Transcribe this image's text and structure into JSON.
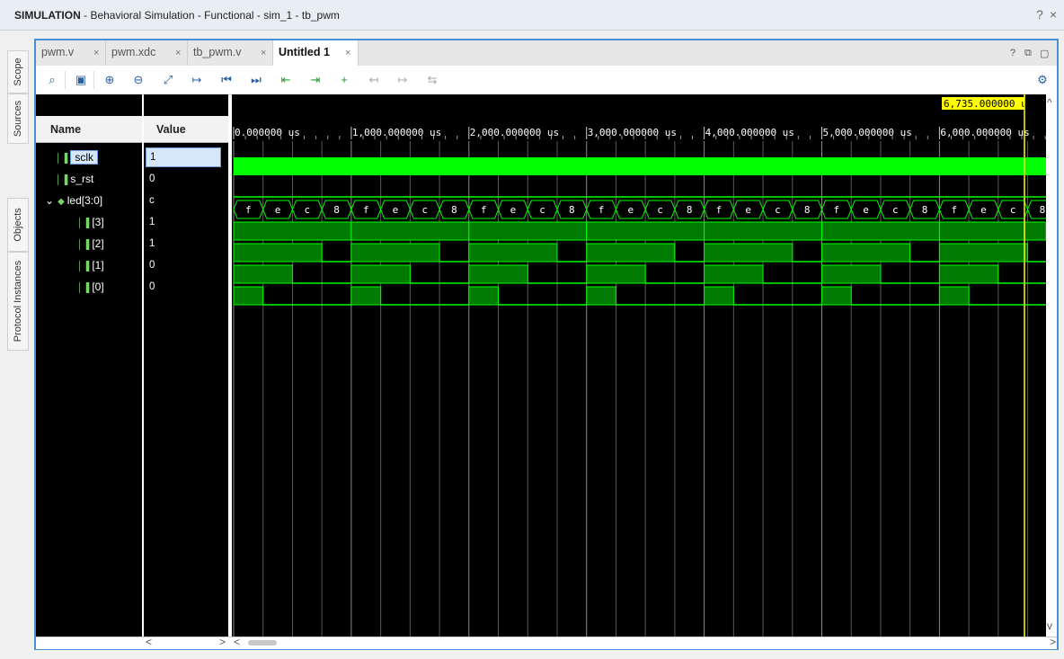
{
  "window": {
    "title_prefix": "SIMULATION",
    "title_rest": " - Behavioral Simulation - Functional - sim_1 - tb_pwm",
    "help": "?",
    "close": "×"
  },
  "side_tabs": [
    "Scope",
    "Sources",
    "Objects",
    "Protocol Instances"
  ],
  "tabs": [
    {
      "label": "pwm.v",
      "active": false
    },
    {
      "label": "pwm.xdc",
      "active": false
    },
    {
      "label": "tb_pwm.v",
      "active": false
    },
    {
      "label": "Untitled 1",
      "active": true
    }
  ],
  "tab_close": "×",
  "panel_controls": {
    "help": "?",
    "restore": "⧉",
    "maximize": "▢"
  },
  "toolbar": {
    "icons": [
      "search-icon",
      "save-icon",
      "zoom-in-icon",
      "zoom-out-icon",
      "zoom-fit-icon",
      "go-to-cursor-icon",
      "go-to-time-0-icon",
      "go-to-last-time-icon",
      "previous-transition-icon",
      "next-transition-icon",
      "add-marker-icon",
      "previous-marker-icon",
      "next-marker-icon",
      "swap-cursors-icon"
    ],
    "settings_icon": "gear-icon"
  },
  "columns": {
    "name": "Name",
    "value": "Value"
  },
  "cursor_time": "6,735.000000 u",
  "time_ticks": [
    "0.000000 us",
    "1,000.000000 us",
    "2,000.000000 us",
    "3,000.000000 us",
    "4,000.000000 us",
    "5,000.000000 us",
    "6,000.000000 us"
  ],
  "signals": [
    {
      "name": "sclk",
      "value": "1",
      "indent": 0,
      "selected": true
    },
    {
      "name": "s_rst",
      "value": "0",
      "indent": 0,
      "selected": false
    },
    {
      "name": "led[3:0]",
      "value": "c",
      "indent": 0,
      "selected": false,
      "expander": "⌄"
    },
    {
      "name": "[3]",
      "value": "1",
      "indent": 1,
      "selected": false
    },
    {
      "name": "[2]",
      "value": "1",
      "indent": 1,
      "selected": false
    },
    {
      "name": "[1]",
      "value": "0",
      "indent": 1,
      "selected": false
    },
    {
      "name": "[0]",
      "value": "0",
      "indent": 1,
      "selected": false
    }
  ],
  "bus_values": [
    "f",
    "e",
    "c",
    "8",
    "f",
    "e",
    "c",
    "8",
    "f",
    "e",
    "c",
    "8",
    "f",
    "e",
    "c",
    "8",
    "f",
    "e",
    "c",
    "8",
    "f",
    "e",
    "c",
    "8",
    "f",
    "e",
    "c",
    "8"
  ],
  "colors": {
    "wave": "#00ff00",
    "wave_fill": "#007a00",
    "cursor": "#ffff00",
    "selection": "#d7e7fb",
    "accent": "#4a90d9"
  },
  "scroll_left": "<",
  "scroll_right": ">",
  "scroll_up": "^",
  "scroll_down": "v"
}
